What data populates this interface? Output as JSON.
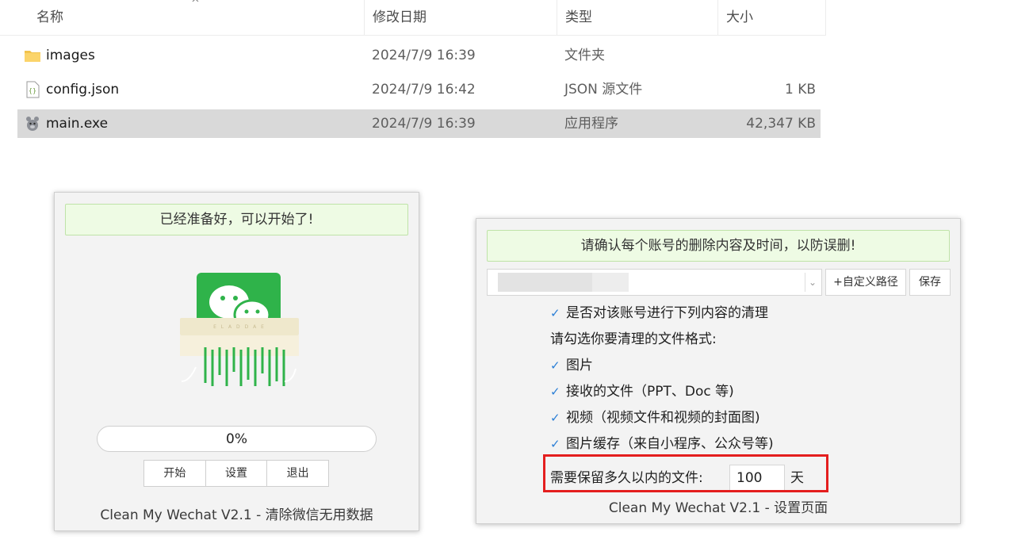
{
  "explorer": {
    "columns": {
      "name": "名称",
      "date": "修改日期",
      "type": "类型",
      "size": "大小"
    },
    "sort_caret": "^",
    "files": [
      {
        "name": "images",
        "date": "2024/7/9 16:39",
        "type": "文件夹",
        "size": "",
        "icon": "folder-icon"
      },
      {
        "name": "config.json",
        "date": "2024/7/9 16:42",
        "type": "JSON 源文件",
        "size": "1 KB",
        "icon": "json-file-icon"
      },
      {
        "name": "main.exe",
        "date": "2024/7/9 16:39",
        "type": "应用程序",
        "size": "42,347 KB",
        "icon": "app-icon"
      }
    ],
    "selected_row": 2
  },
  "app_main": {
    "banner": "已经准备好，可以开始了!",
    "progress": "0%",
    "progress_fraction": 0,
    "buttons": {
      "start": "开始",
      "settings": "设置",
      "exit": "退出"
    },
    "footer": "Clean My Wechat V2.1 - 清除微信无用数据"
  },
  "app_settings": {
    "banner": "请确认每个账号的删除内容及时间，以防误删!",
    "custom_path_label": "+自定义路径",
    "save_label": "保存",
    "options": [
      {
        "label": "是否对该账号进行下列内容的清理",
        "checked": true
      },
      {
        "label": "请勾选你要清理的文件格式:",
        "checked": false,
        "is_header": true
      },
      {
        "label": "图片",
        "checked": true
      },
      {
        "label": "接收的文件（PPT、Doc 等)",
        "checked": true
      },
      {
        "label": "视频（视频文件和视频的封面图)",
        "checked": true
      },
      {
        "label": "图片缓存（来自小程序、公众号等)",
        "checked": true
      }
    ],
    "keep_label": "需要保留多久以内的文件:",
    "keep_value": "100",
    "keep_unit": "天",
    "footer": "Clean My Wechat V2.1 - 设置页面"
  },
  "colors": {
    "banner_bg": "#eefbe4",
    "banner_border": "#bfe3a8",
    "check": "#2b7fd6",
    "highlight_box": "#e41e1e",
    "wechat_green": "#2fb34a",
    "selection": "#d9d9d9"
  }
}
